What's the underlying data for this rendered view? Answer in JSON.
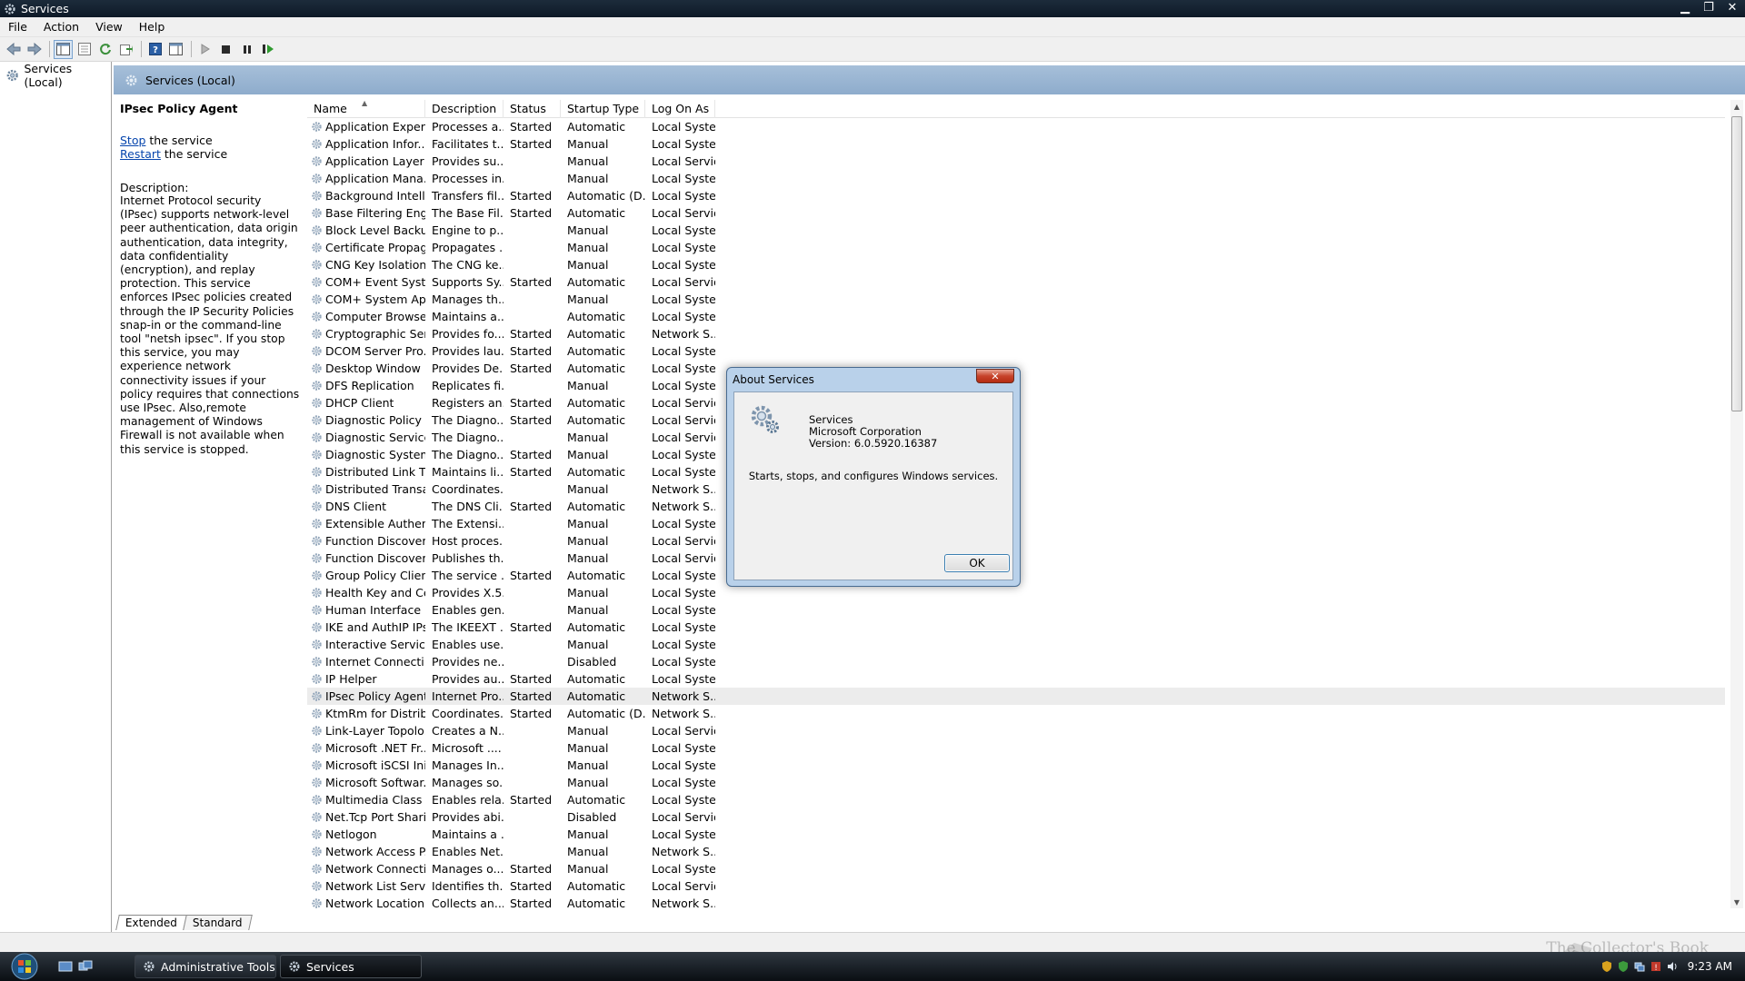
{
  "window": {
    "title": "Services"
  },
  "menu": [
    "File",
    "Action",
    "View",
    "Help"
  ],
  "tree": {
    "root": "Services (Local)"
  },
  "header": {
    "title": "Services (Local)"
  },
  "extended": {
    "service_name": "IPsec Policy Agent",
    "stop_link": "Stop",
    "stop_suffix": " the service",
    "restart_link": "Restart",
    "restart_suffix": " the service",
    "description_label": "Description:",
    "description": "Internet Protocol security (IPsec) supports network-level peer authentication, data origin authentication, data integrity, data confidentiality (encryption), and replay protection.  This service enforces IPsec policies created through the IP Security Policies snap-in or the command-line tool \"netsh ipsec\".  If you stop this service, you may experience network connectivity issues if your policy requires that connections use IPsec.  Also,remote management of Windows Firewall is not available when this service is stopped."
  },
  "columns": [
    "Name",
    "Description",
    "Status",
    "Startup Type",
    "Log On As"
  ],
  "services": [
    [
      "Application Experi...",
      "Processes a...",
      "Started",
      "Automatic",
      "Local Syste..."
    ],
    [
      "Application Infor...",
      "Facilitates t...",
      "Started",
      "Manual",
      "Local Syste..."
    ],
    [
      "Application Layer ...",
      "Provides su...",
      "",
      "Manual",
      "Local Service"
    ],
    [
      "Application Mana...",
      "Processes in...",
      "",
      "Manual",
      "Local Syste..."
    ],
    [
      "Background Intelli...",
      "Transfers fil...",
      "Started",
      "Automatic (D...",
      "Local Syste..."
    ],
    [
      "Base Filtering Engi...",
      "The Base Fil...",
      "Started",
      "Automatic",
      "Local Service"
    ],
    [
      "Block Level Backu...",
      "Engine to p...",
      "",
      "Manual",
      "Local Syste..."
    ],
    [
      "Certificate Propag...",
      "Propagates ...",
      "",
      "Manual",
      "Local Syste..."
    ],
    [
      "CNG Key Isolation",
      "The CNG ke...",
      "",
      "Manual",
      "Local Syste..."
    ],
    [
      "COM+ Event Syst...",
      "Supports Sy...",
      "Started",
      "Automatic",
      "Local Service"
    ],
    [
      "COM+ System Ap...",
      "Manages th...",
      "",
      "Manual",
      "Local Syste..."
    ],
    [
      "Computer Browser",
      "Maintains a...",
      "",
      "Automatic",
      "Local Syste..."
    ],
    [
      "Cryptographic Ser...",
      "Provides fo...",
      "Started",
      "Automatic",
      "Network S..."
    ],
    [
      "DCOM Server Pro...",
      "Provides lau...",
      "Started",
      "Automatic",
      "Local Syste..."
    ],
    [
      "Desktop Window ...",
      "Provides De...",
      "Started",
      "Automatic",
      "Local Syste..."
    ],
    [
      "DFS Replication",
      "Replicates fi...",
      "",
      "Manual",
      "Local Syste..."
    ],
    [
      "DHCP Client",
      "Registers an...",
      "Started",
      "Automatic",
      "Local Service"
    ],
    [
      "Diagnostic Policy ...",
      "The Diagno...",
      "Started",
      "Automatic",
      "Local Service"
    ],
    [
      "Diagnostic Service...",
      "The Diagno...",
      "",
      "Manual",
      "Local Service"
    ],
    [
      "Diagnostic System...",
      "The Diagno...",
      "Started",
      "Manual",
      "Local Syste..."
    ],
    [
      "Distributed Link Tr...",
      "Maintains li...",
      "Started",
      "Automatic",
      "Local Syste..."
    ],
    [
      "Distributed Transa...",
      "Coordinates...",
      "",
      "Manual",
      "Network S..."
    ],
    [
      "DNS Client",
      "The DNS Cli...",
      "Started",
      "Automatic",
      "Network S..."
    ],
    [
      "Extensible Authen...",
      "The Extensi...",
      "",
      "Manual",
      "Local Syste..."
    ],
    [
      "Function Discover...",
      "Host proces...",
      "",
      "Manual",
      "Local Service"
    ],
    [
      "Function Discover...",
      "Publishes th...",
      "",
      "Manual",
      "Local Service"
    ],
    [
      "Group Policy Client",
      "The service ...",
      "Started",
      "Automatic",
      "Local Syste..."
    ],
    [
      "Health Key and Ce...",
      "Provides X.5...",
      "",
      "Manual",
      "Local Syste..."
    ],
    [
      "Human Interface ...",
      "Enables gen...",
      "",
      "Manual",
      "Local Syste..."
    ],
    [
      "IKE and AuthIP IPs...",
      "The IKEEXT ...",
      "Started",
      "Automatic",
      "Local Syste..."
    ],
    [
      "Interactive Service...",
      "Enables use...",
      "",
      "Manual",
      "Local Syste..."
    ],
    [
      "Internet Connecti...",
      "Provides ne...",
      "",
      "Disabled",
      "Local Syste..."
    ],
    [
      "IP Helper",
      "Provides au...",
      "Started",
      "Automatic",
      "Local Syste..."
    ],
    [
      "IPsec Policy Agent",
      "Internet Pro...",
      "Started",
      "Automatic",
      "Network S..."
    ],
    [
      "KtmRm for Distrib...",
      "Coordinates...",
      "Started",
      "Automatic (D...",
      "Network S..."
    ],
    [
      "Link-Layer Topolo...",
      "Creates a N...",
      "",
      "Manual",
      "Local Service"
    ],
    [
      "Microsoft .NET Fr...",
      "Microsoft ....",
      "",
      "Manual",
      "Local Syste..."
    ],
    [
      "Microsoft iSCSI Ini...",
      "Manages In...",
      "",
      "Manual",
      "Local Syste..."
    ],
    [
      "Microsoft Softwar...",
      "Manages so...",
      "",
      "Manual",
      "Local Syste..."
    ],
    [
      "Multimedia Class ...",
      "Enables rela...",
      "Started",
      "Automatic",
      "Local Syste..."
    ],
    [
      "Net.Tcp Port Shari...",
      "Provides abi...",
      "",
      "Disabled",
      "Local Service"
    ],
    [
      "Netlogon",
      "Maintains a ...",
      "",
      "Manual",
      "Local Syste..."
    ],
    [
      "Network Access P...",
      "Enables Net...",
      "",
      "Manual",
      "Network S..."
    ],
    [
      "Network Connecti...",
      "Manages o...",
      "Started",
      "Manual",
      "Local Syste..."
    ],
    [
      "Network List Service",
      "Identifies th...",
      "Started",
      "Automatic",
      "Local Service"
    ],
    [
      "Network Location ...",
      "Collects an...",
      "Started",
      "Automatic",
      "Network S..."
    ]
  ],
  "selected_row": 33,
  "tabs": [
    "Extended",
    "Standard"
  ],
  "dialog": {
    "title": "About Services",
    "close": "✕",
    "product": "Services",
    "company": "Microsoft Corporation",
    "version": "Version: 6.0.5920.16387",
    "tagline": "Starts, stops, and configures Windows services.",
    "ok": "OK"
  },
  "taskbar": {
    "tasks": [
      "Administrative Tools",
      "Services"
    ],
    "clock": "9:23 AM"
  },
  "watermark": "The Collector's Book",
  "icons": {
    "service": "gear-icon",
    "back": "back-arrow-icon",
    "forward": "forward-arrow-icon",
    "play": "play-icon",
    "stop": "stop-icon",
    "pause": "pause-icon",
    "restart": "restart-icon",
    "help": "help-icon"
  },
  "colors": {
    "header_blue": "#9bb6d4",
    "taskbar": "#1a2028",
    "link": "#0645ad",
    "close_red": "#c7432b"
  }
}
